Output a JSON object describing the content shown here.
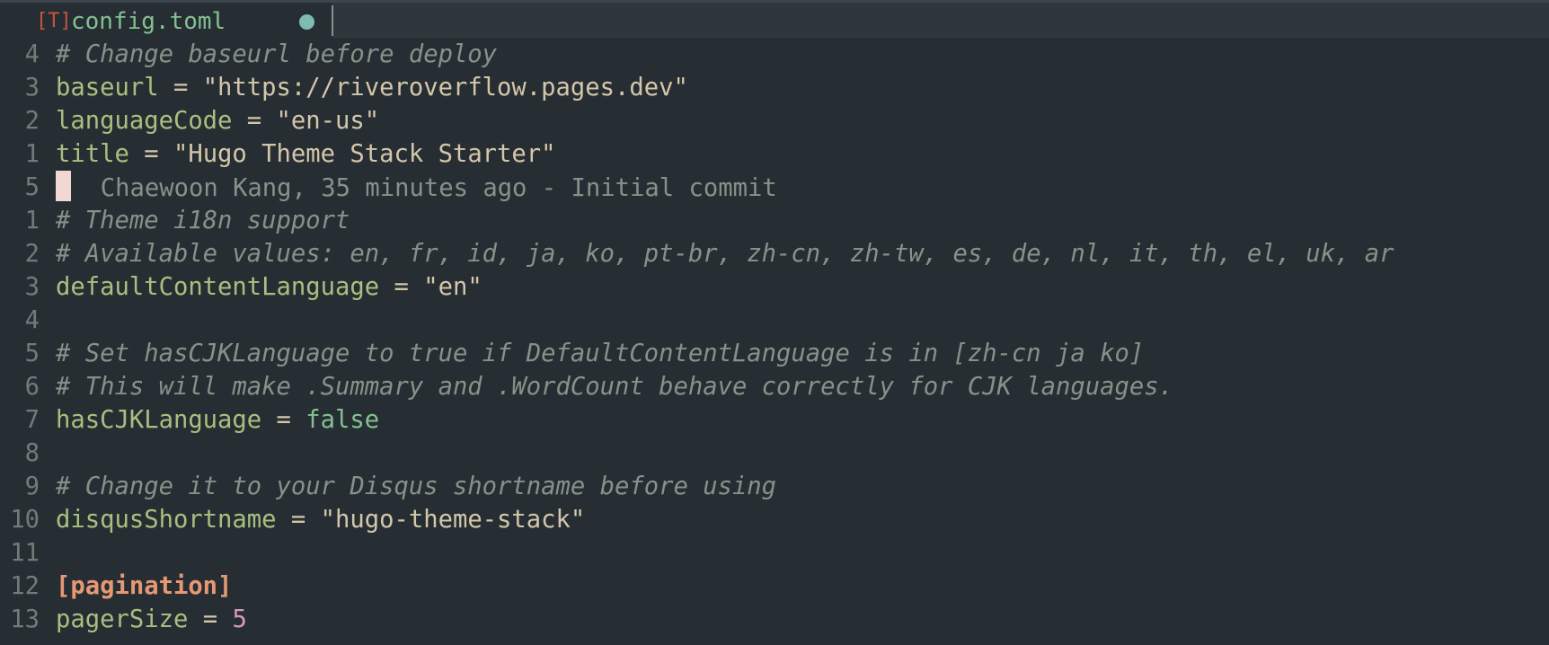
{
  "tab": {
    "icon_label": "[T]",
    "filename": "config.toml"
  },
  "lines": [
    {
      "num": "4",
      "kind": "comment",
      "text": "# Change baseurl before deploy"
    },
    {
      "num": "3",
      "kind": "kv",
      "key": "baseurl",
      "op": " = ",
      "value": "\"https://riveroverflow.pages.dev\"",
      "value_kind": "str"
    },
    {
      "num": "2",
      "kind": "kv",
      "key": "languageCode",
      "op": " = ",
      "value": "\"en-us\"",
      "value_kind": "str"
    },
    {
      "num": "1",
      "kind": "kv",
      "key": "title",
      "op": " = ",
      "value": "\"Hugo Theme Stack Starter\"",
      "value_kind": "str"
    },
    {
      "num": "5",
      "kind": "cursor",
      "blame": "Chaewoon Kang, 35 minutes ago - Initial commit"
    },
    {
      "num": "1",
      "kind": "comment",
      "text": "# Theme i18n support"
    },
    {
      "num": "2",
      "kind": "comment",
      "text": "# Available values: en, fr, id, ja, ko, pt-br, zh-cn, zh-tw, es, de, nl, it, th, el, uk, ar"
    },
    {
      "num": "3",
      "kind": "kv",
      "key": "defaultContentLanguage",
      "op": " = ",
      "value": "\"en\"",
      "value_kind": "str"
    },
    {
      "num": "4",
      "kind": "empty"
    },
    {
      "num": "5",
      "kind": "comment",
      "text": "# Set hasCJKLanguage to true if DefaultContentLanguage is in [zh-cn ja ko]"
    },
    {
      "num": "6",
      "kind": "comment",
      "text": "# This will make .Summary and .WordCount behave correctly for CJK languages."
    },
    {
      "num": "7",
      "kind": "kv",
      "key": "hasCJKLanguage",
      "op": " = ",
      "value": "false",
      "value_kind": "bool"
    },
    {
      "num": "8",
      "kind": "empty"
    },
    {
      "num": "9",
      "kind": "comment",
      "text": "# Change it to your Disqus shortname before using"
    },
    {
      "num": "10",
      "kind": "kv",
      "key": "disqusShortname",
      "op": " = ",
      "value": "\"hugo-theme-stack\"",
      "value_kind": "str"
    },
    {
      "num": "11",
      "kind": "empty"
    },
    {
      "num": "12",
      "kind": "table",
      "text": "[pagination]"
    },
    {
      "num": "13",
      "kind": "kv",
      "key": "pagerSize",
      "op": " = ",
      "value": "5",
      "value_kind": "num"
    }
  ],
  "colors": {
    "background": "#272e33",
    "comment": "#859289",
    "key": "#a7c080",
    "string": "#d3c6aa",
    "boolean": "#83c092",
    "number": "#d699b6",
    "table": "#e69875",
    "cursor": "#f2d8d3",
    "tab_dot": "#7fbbb3"
  }
}
